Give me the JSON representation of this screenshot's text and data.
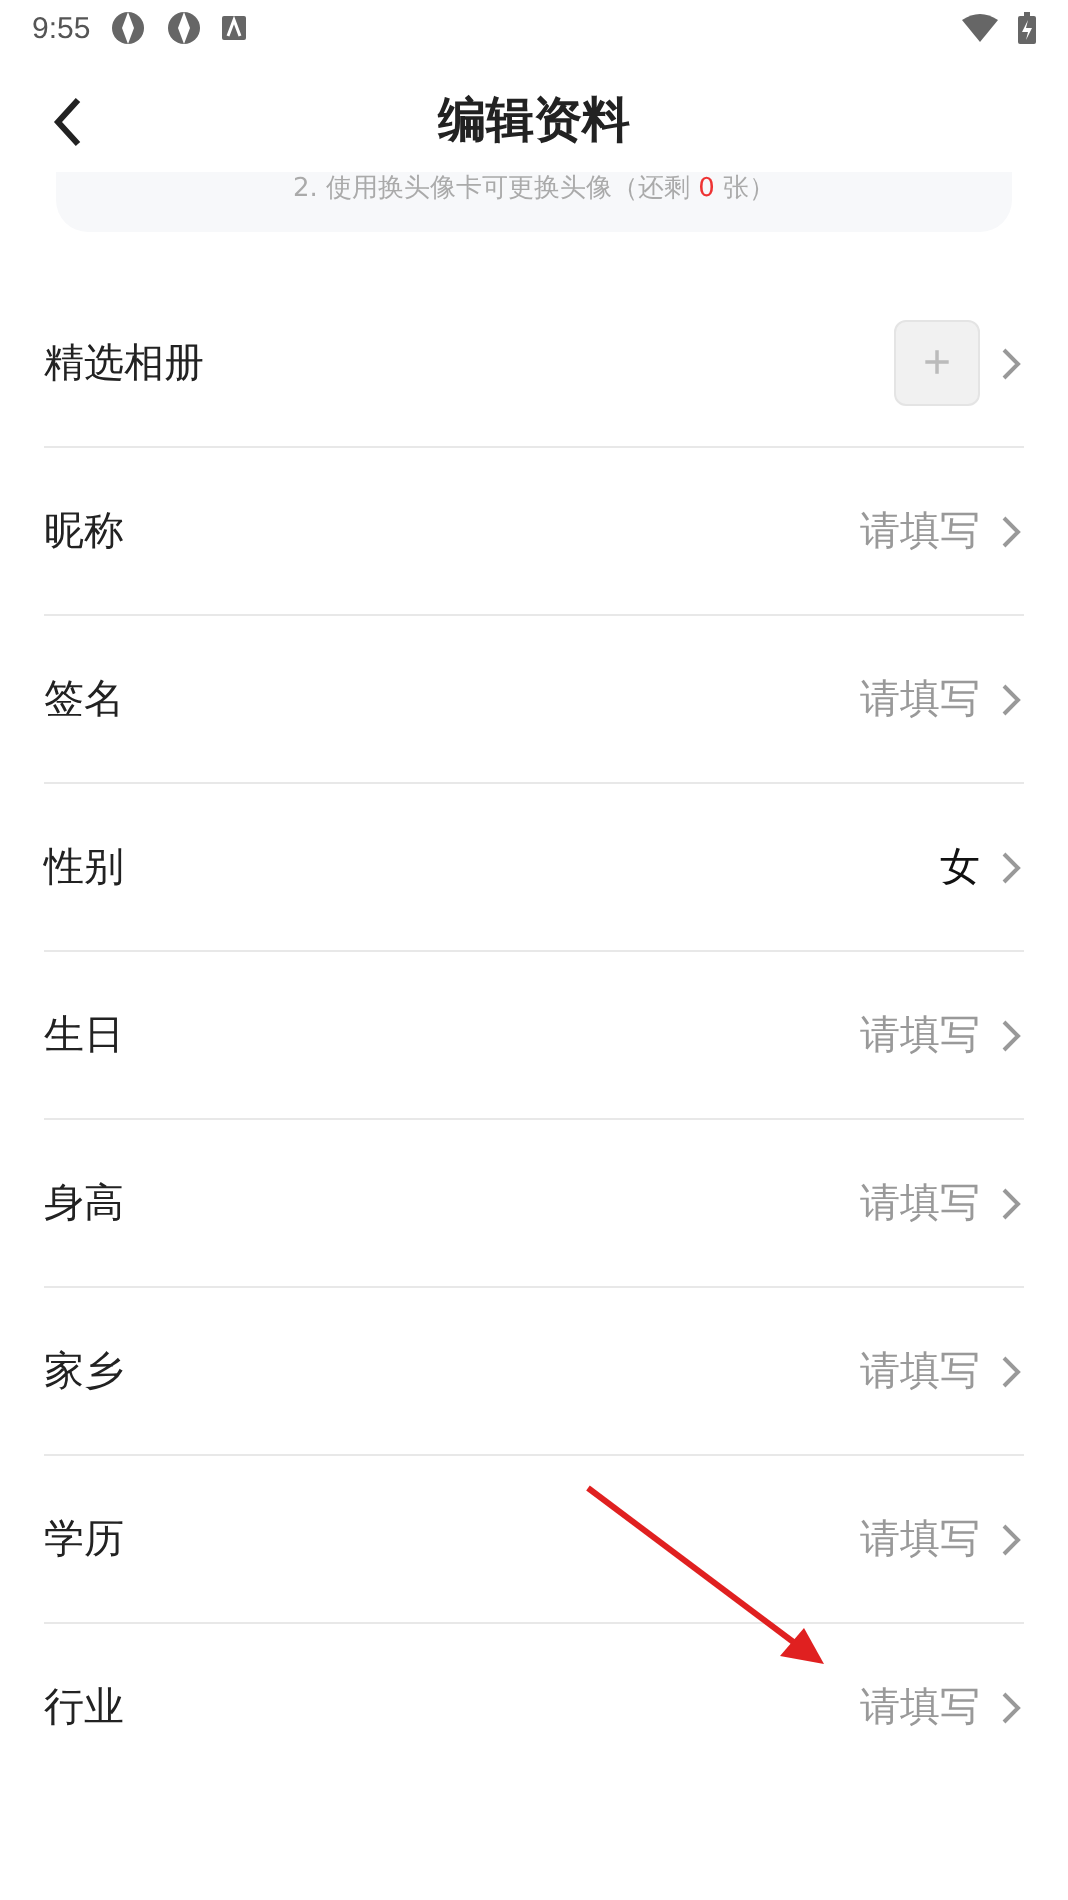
{
  "status_bar": {
    "time": "9:55"
  },
  "header": {
    "title": "编辑资料"
  },
  "notice": {
    "text": "2. 使用换头像卡可更换头像（还剩 ",
    "count": "0",
    "suffix": " 张）"
  },
  "rows": [
    {
      "kind": "album",
      "label": "精选相册",
      "plus": "+"
    },
    {
      "kind": "field",
      "label": "昵称",
      "value": "请填写",
      "filled": false
    },
    {
      "kind": "field",
      "label": "签名",
      "value": "请填写",
      "filled": false
    },
    {
      "kind": "field",
      "label": "性别",
      "value": "女",
      "filled": true
    },
    {
      "kind": "field",
      "label": "生日",
      "value": "请填写",
      "filled": false
    },
    {
      "kind": "field",
      "label": "身高",
      "value": "请填写",
      "filled": false
    },
    {
      "kind": "field",
      "label": "家乡",
      "value": "请填写",
      "filled": false
    },
    {
      "kind": "field",
      "label": "学历",
      "value": "请填写",
      "filled": false
    },
    {
      "kind": "field",
      "label": "行业",
      "value": "请填写",
      "filled": false
    }
  ]
}
